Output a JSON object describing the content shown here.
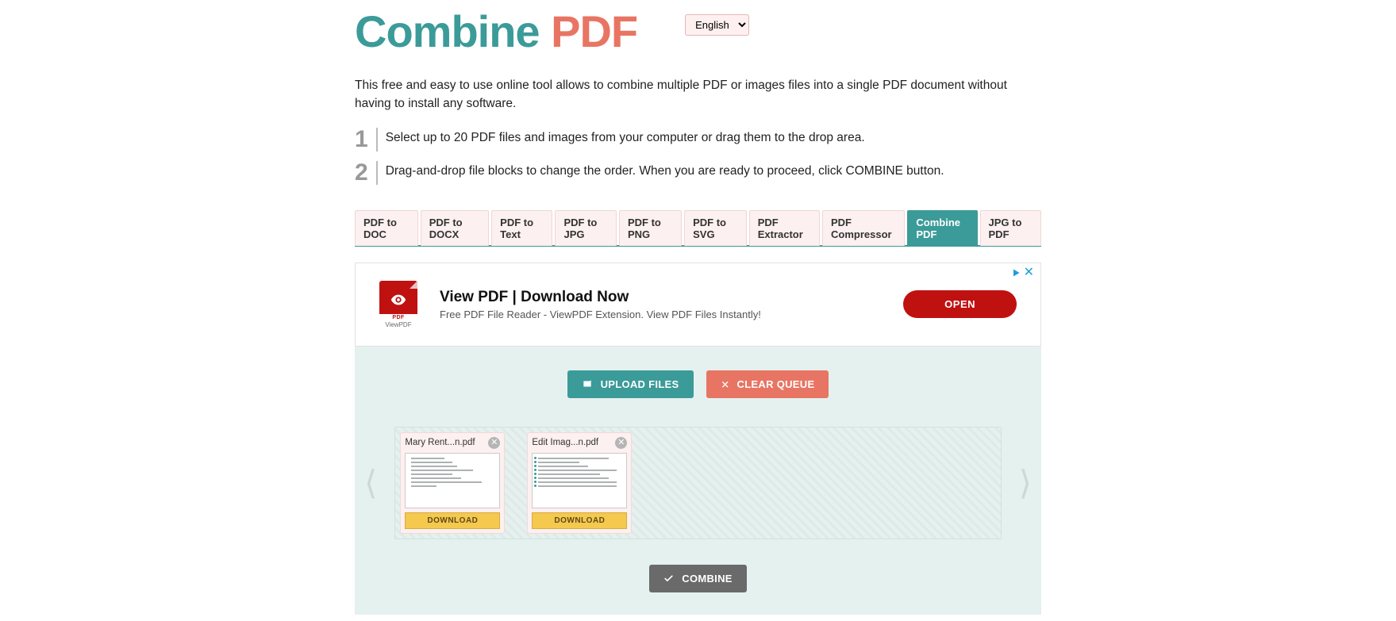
{
  "logo": {
    "part1": "Combine",
    "part2": "PDF"
  },
  "language": {
    "selected": "English",
    "options": [
      "English"
    ]
  },
  "intro": "This free and easy to use online tool allows to combine multiple PDF or images files into a single PDF document without having to install any software.",
  "steps": [
    {
      "num": "1",
      "text": "Select up to 20 PDF files and images from your computer or drag them to the drop area."
    },
    {
      "num": "2",
      "text": "Drag-and-drop file blocks to change the order. When you are ready to proceed, click COMBINE button."
    }
  ],
  "tabs": [
    {
      "label": "PDF to DOC",
      "active": false
    },
    {
      "label": "PDF to DOCX",
      "active": false
    },
    {
      "label": "PDF to Text",
      "active": false
    },
    {
      "label": "PDF to JPG",
      "active": false
    },
    {
      "label": "PDF to PNG",
      "active": false
    },
    {
      "label": "PDF to SVG",
      "active": false
    },
    {
      "label": "PDF Extractor",
      "active": false
    },
    {
      "label": "PDF Compressor",
      "active": false
    },
    {
      "label": "Combine PDF",
      "active": true
    },
    {
      "label": "JPG to PDF",
      "active": false
    }
  ],
  "ad": {
    "icon_label": "PDF",
    "icon_sub": "ViewPDF",
    "title": "View PDF | Download Now",
    "sub": "Free PDF File Reader - ViewPDF Extension. View PDF Files Instantly!",
    "cta": "OPEN"
  },
  "buttons": {
    "upload": "UPLOAD FILES",
    "clear": "CLEAR QUEUE",
    "combine": "COMBINE"
  },
  "files": [
    {
      "name": "Mary Rent...n.pdf",
      "download": "DOWNLOAD",
      "thumb": "plain"
    },
    {
      "name": "Edit Imag...n.pdf",
      "download": "DOWNLOAD",
      "thumb": "bullets"
    }
  ]
}
